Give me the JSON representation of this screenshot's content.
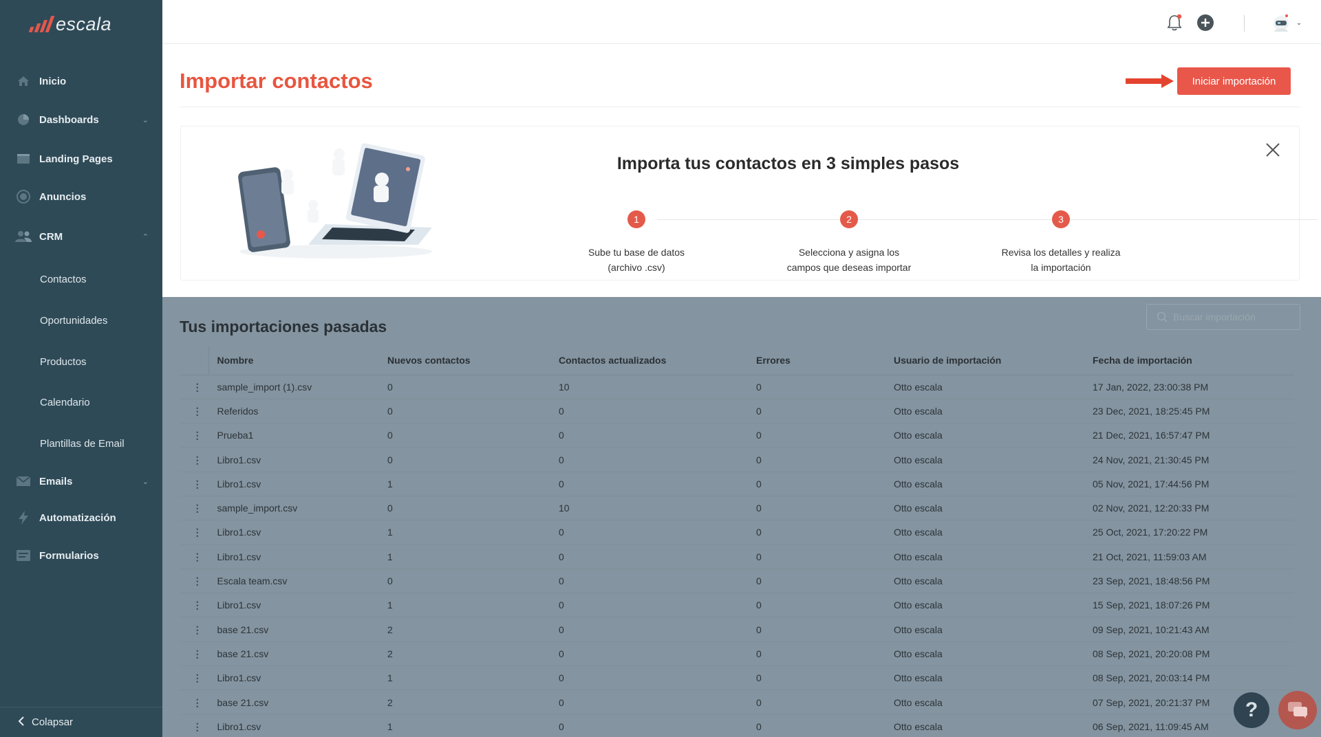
{
  "brand": {
    "name": "escala"
  },
  "sidebar": {
    "items": [
      {
        "label": "Inicio",
        "icon": "home-icon"
      },
      {
        "label": "Dashboards",
        "icon": "pie-chart-icon"
      },
      {
        "label": "Landing Pages",
        "icon": "browser-window-icon"
      },
      {
        "label": "Anuncios",
        "icon": "megaphone-icon"
      },
      {
        "label": "CRM",
        "icon": "users-icon"
      },
      {
        "label": "Emails",
        "icon": "envelope-icon"
      },
      {
        "label": "Automatización",
        "icon": "lightning-icon"
      },
      {
        "label": "Formularios",
        "icon": "form-icon"
      }
    ],
    "crm_subitems": [
      "Contactos",
      "Oportunidades",
      "Productos",
      "Calendario",
      "Plantillas de Email"
    ],
    "collapse_label": "Colapsar"
  },
  "header": {
    "title": "Importar contactos",
    "primary_button": "Iniciar importación"
  },
  "steps_card": {
    "title": "Importa tus contactos en 3 simples pasos",
    "steps": [
      {
        "number": "1",
        "line1": "Sube tu base de datos",
        "line2": "(archivo .csv)"
      },
      {
        "number": "2",
        "line1": "Selecciona y asigna los",
        "line2": "campos que deseas importar"
      },
      {
        "number": "3",
        "line1": "Revisa los detalles y realiza",
        "line2": "la importación"
      }
    ]
  },
  "imports": {
    "title": "Tus importaciones pasadas",
    "search_placeholder": "Buscar importación",
    "columns": [
      "Nombre",
      "Nuevos contactos",
      "Contactos actualizados",
      "Errores",
      "Usuario de importación",
      "Fecha de importación"
    ],
    "rows": [
      [
        "sample_import (1).csv",
        "0",
        "10",
        "0",
        "Otto escala",
        "17 Jan, 2022, 23:00:38 PM"
      ],
      [
        "Referidos",
        "0",
        "0",
        "0",
        "Otto escala",
        "23 Dec, 2021, 18:25:45 PM"
      ],
      [
        "Prueba1",
        "0",
        "0",
        "0",
        "Otto escala",
        "21 Dec, 2021, 16:57:47 PM"
      ],
      [
        "Libro1.csv",
        "0",
        "0",
        "0",
        "Otto escala",
        "24 Nov, 2021, 21:30:45 PM"
      ],
      [
        "Libro1.csv",
        "1",
        "0",
        "0",
        "Otto escala",
        "05 Nov, 2021, 17:44:56 PM"
      ],
      [
        "sample_import.csv",
        "0",
        "10",
        "0",
        "Otto escala",
        "02 Nov, 2021, 12:20:33 PM"
      ],
      [
        "Libro1.csv",
        "1",
        "0",
        "0",
        "Otto escala",
        "25 Oct, 2021, 17:20:22 PM"
      ],
      [
        "Libro1.csv",
        "1",
        "0",
        "0",
        "Otto escala",
        "21 Oct, 2021, 11:59:03 AM"
      ],
      [
        "Escala team.csv",
        "0",
        "0",
        "0",
        "Otto escala",
        "23 Sep, 2021, 18:48:56 PM"
      ],
      [
        "Libro1.csv",
        "1",
        "0",
        "0",
        "Otto escala",
        "15 Sep, 2021, 18:07:26 PM"
      ],
      [
        "base 21.csv",
        "2",
        "0",
        "0",
        "Otto escala",
        "09 Sep, 2021, 10:21:43 AM"
      ],
      [
        "base 21.csv",
        "2",
        "0",
        "0",
        "Otto escala",
        "08 Sep, 2021, 20:20:08 PM"
      ],
      [
        "Libro1.csv",
        "1",
        "0",
        "0",
        "Otto escala",
        "08 Sep, 2021, 20:03:14 PM"
      ],
      [
        "base 21.csv",
        "2",
        "0",
        "0",
        "Otto escala",
        "07 Sep, 2021, 20:21:37 PM"
      ],
      [
        "Libro1.csv",
        "1",
        "0",
        "0",
        "Otto escala",
        "06 Sep, 2021, 11:09:45 AM"
      ]
    ]
  },
  "floating": {
    "help_label": "?"
  },
  "colors": {
    "accent": "#e9574a",
    "sidebar": "#2f4a57",
    "overlay": "#8494a0"
  }
}
